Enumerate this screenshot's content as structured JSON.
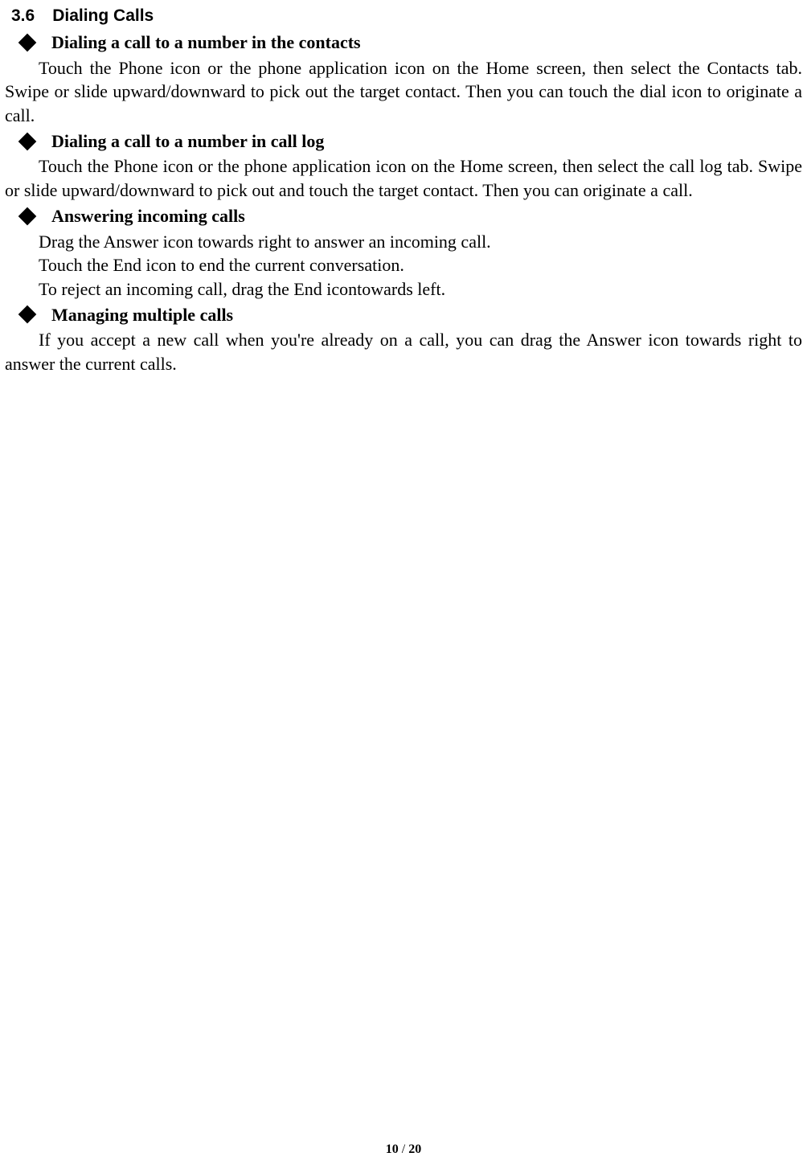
{
  "section": {
    "number": "3.6",
    "title": "Dialing Calls"
  },
  "items": [
    {
      "heading": "Dialing a call to a number in the contacts",
      "paragraphs": [
        "Touch the Phone icon or the phone application icon on the Home screen, then select the Contacts tab. Swipe or slide upward/downward to pick out the target contact. Then you can touch the dial icon to originate a call."
      ]
    },
    {
      "heading": "Dialing a call to a number in call log",
      "paragraphs": [
        "Touch the Phone icon or the phone application icon on the Home screen, then select the call log tab. Swipe or slide upward/downward to pick out and touch the target contact. Then you can originate a call."
      ]
    },
    {
      "heading": "Answering incoming calls",
      "paragraphs": [
        "Drag the Answer icon towards right to answer an incoming call.",
        "Touch the End icon to end the current conversation.",
        "To reject an incoming call, drag the End icontowards left."
      ]
    },
    {
      "heading": "Managing multiple calls",
      "paragraphs": [
        "If you accept a new call when you're already on a call, you can drag the Answer icon towards right to answer the current calls."
      ]
    }
  ],
  "footer": {
    "current": "10",
    "sep": " / ",
    "total": "20"
  }
}
